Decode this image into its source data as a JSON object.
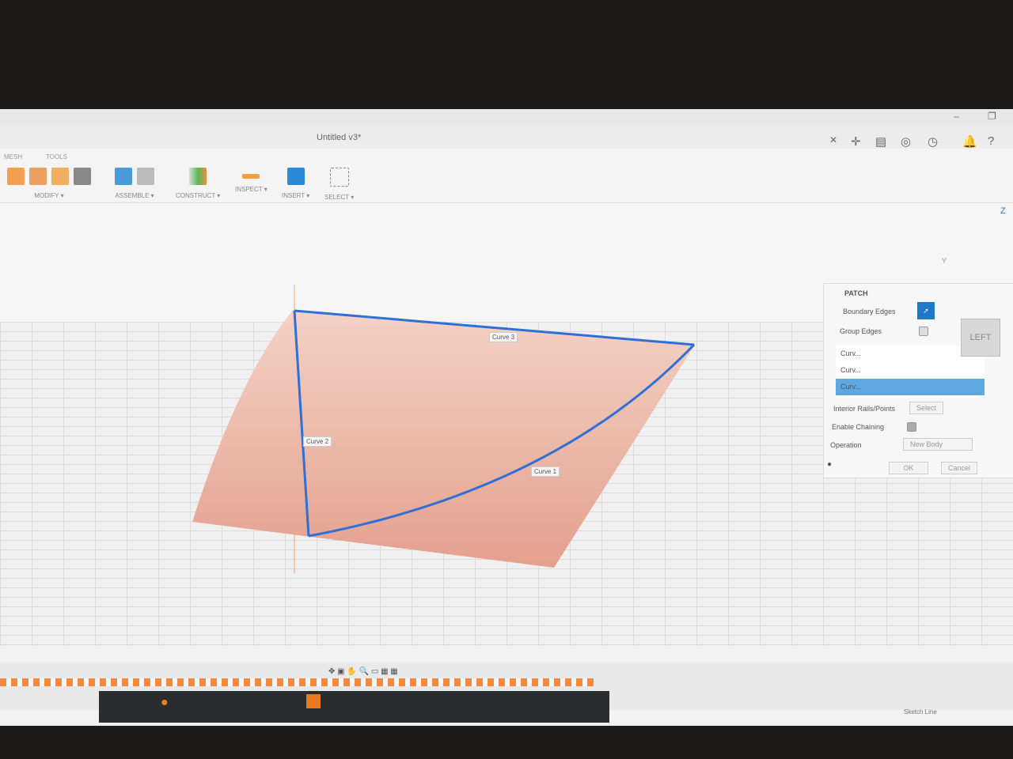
{
  "window": {
    "title": "Untitled v3*",
    "minimize": "–",
    "maximize": "❐",
    "close": "✕"
  },
  "ribbon": {
    "tabs": [
      "MESH",
      "TOOLS"
    ],
    "groups": [
      "MODIFY ▾",
      "ASSEMBLE ▾",
      "CONSTRUCT ▾",
      "INSPECT ▾",
      "INSERT ▾",
      "SELECT ▾"
    ]
  },
  "viewcube": {
    "face": "LEFT",
    "axis_z": "Z",
    "axis_y": "Y"
  },
  "canvas": {
    "curves": [
      "Curve 3",
      "Curve 2",
      "Curve 1"
    ]
  },
  "patch": {
    "title": "PATCH",
    "boundary_edges": "Boundary Edges",
    "group_edges": "Group Edges",
    "list": [
      "Curv...",
      "Curv...",
      "Curv..."
    ],
    "interior": "Interior Rails/Points",
    "select": "Select",
    "chaining": "Enable Chaining",
    "operation": "Operation",
    "operation_value": "New Body",
    "ok": "OK",
    "cancel": "Cancel"
  },
  "status": {
    "sketch": "Sketch Line"
  },
  "colors": {
    "accent": "#1f78c8",
    "surface": "#e8a898",
    "curve": "#2f6fd6"
  }
}
